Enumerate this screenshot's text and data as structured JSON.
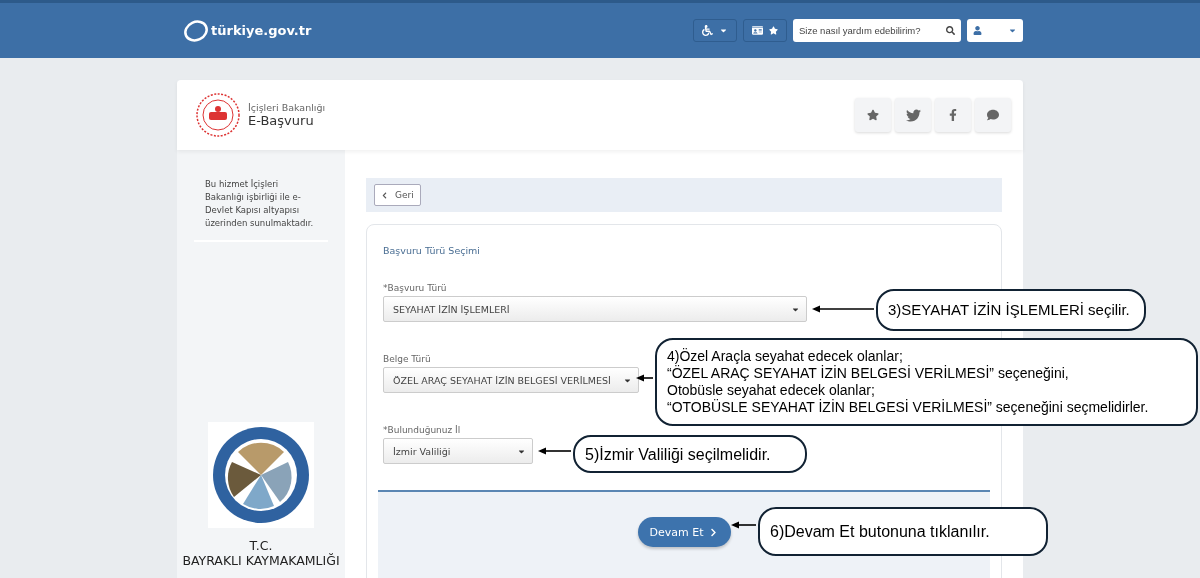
{
  "header": {
    "logo_text": "türkiye.gov.tr",
    "search": {
      "placeholder": "Size nasıl yardım edebilirim?"
    }
  },
  "service": {
    "ministry": "İçişleri Bakanlığı",
    "title": "E-Başvuru"
  },
  "sidebar": {
    "note": "Bu hizmet İçişleri Bakanlığı işbirliği ile e-Devlet Kapısı altyapısı üzerinden sunulmaktadır.",
    "institution": [
      "T.C.",
      "BAYRAKLI KAYMAKAMLIĞI"
    ]
  },
  "back_button": "Geri",
  "form": {
    "title": "Başvuru Türü Seçimi",
    "fields": [
      {
        "label": "*Başvuru Türü",
        "value": "SEYAHAT İZİN İŞLEMLERİ"
      },
      {
        "label": "Belge Türü",
        "value": "ÖZEL ARAÇ SEYAHAT İZİN BELGESİ VERİLMESİ"
      },
      {
        "label": "*Bulunduğunuz İl",
        "value": "İzmir Valiliği"
      }
    ],
    "submit": "Devam Et"
  },
  "callouts": [
    {
      "lines": [
        "3)SEYAHAT İZİN İŞLEMLERİ seçilir."
      ]
    },
    {
      "lines": [
        "4)Özel Araçla seyahat edecek olanlar;",
        "“ÖZEL ARAÇ SEYAHAT İZİN BELGESİ VERİLMESİ” seçeneğini,",
        "Otobüsle seyahat edecek olanlar;",
        "“OTOBÜSLE SEYAHAT İZİN BELGESİ VERİLMESİ” seçeneğini seçmelidirler."
      ]
    },
    {
      "lines": [
        "5)İzmir Valiliği seçilmelidir."
      ]
    },
    {
      "lines": [
        "6)Devam Et butonuna tıklanılır."
      ]
    }
  ]
}
